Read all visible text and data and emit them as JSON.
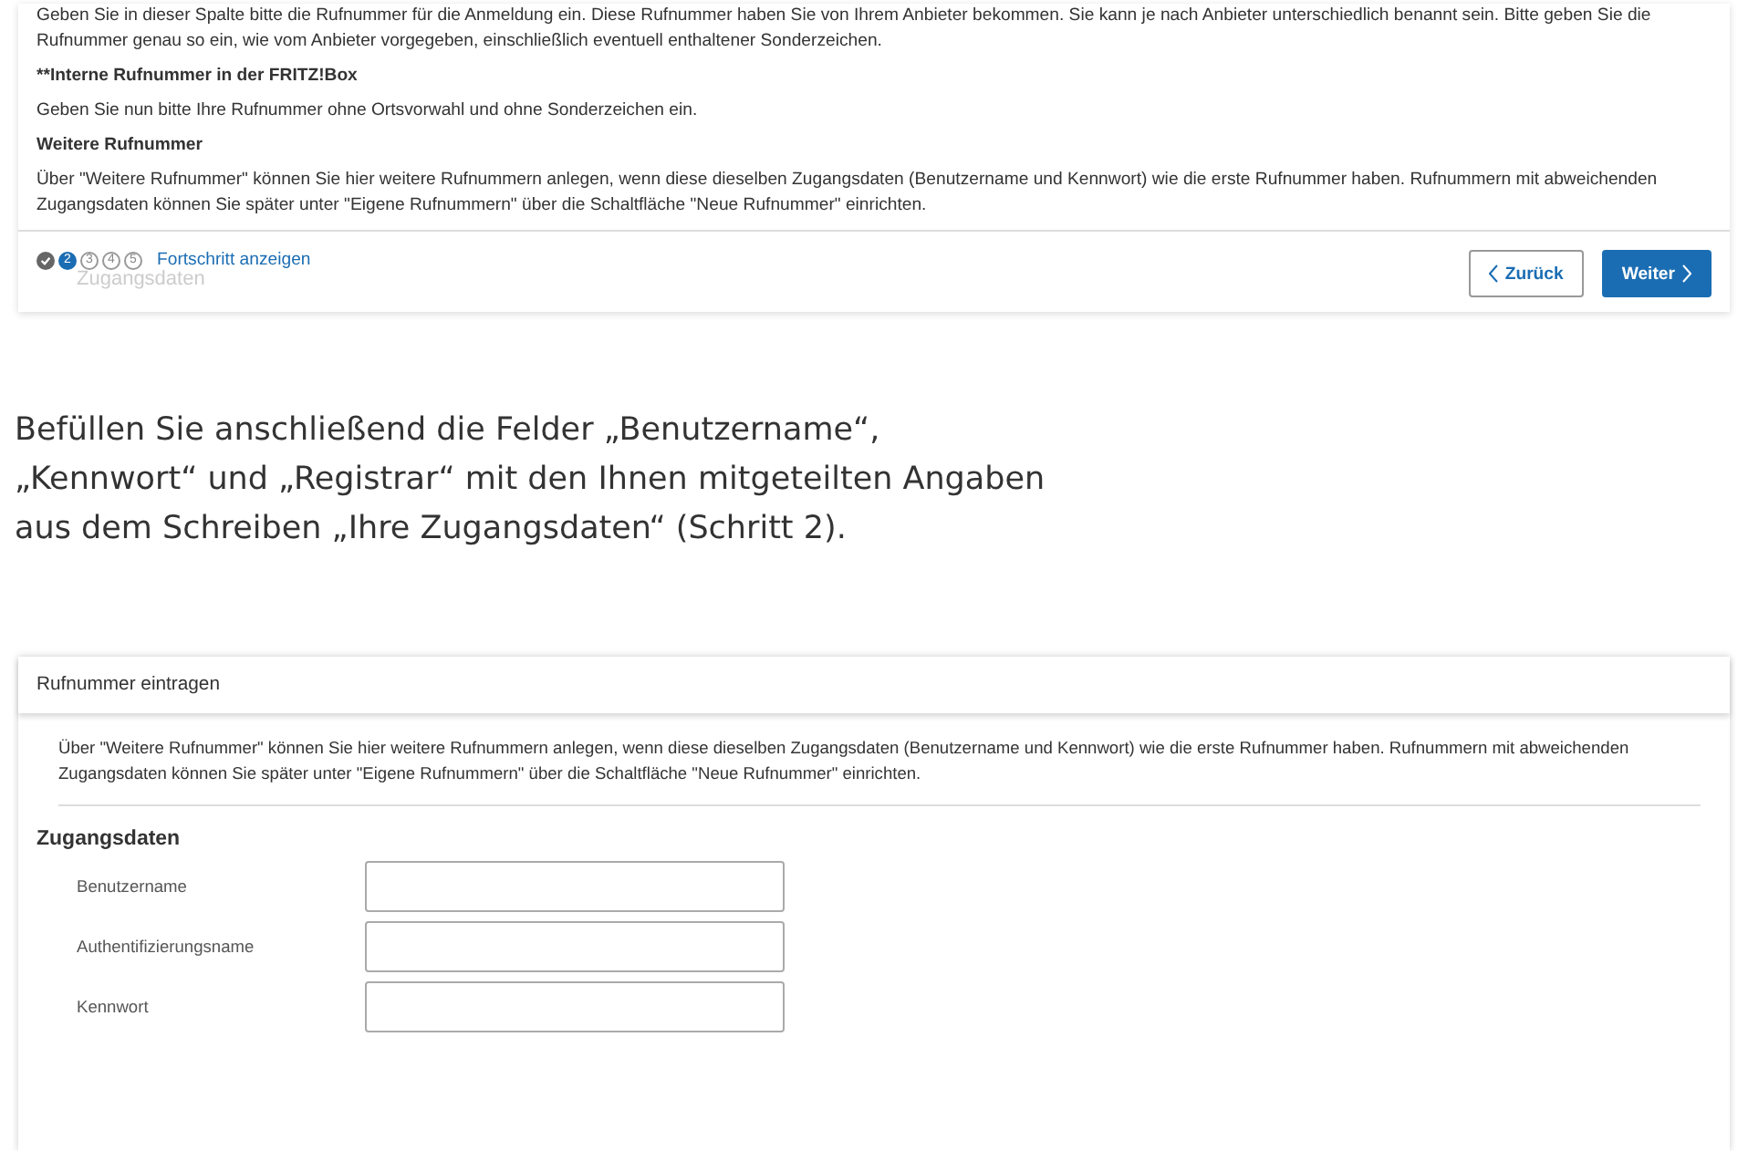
{
  "top_panel": {
    "paragraphs": [
      {
        "kind": "text",
        "text": "Geben Sie in dieser Spalte bitte die Rufnummer für die Anmeldung ein. Diese Rufnummer haben Sie von Ihrem Anbieter bekommen. Sie kann je nach Anbieter unterschiedlich benannt sein. Bitte geben Sie die Rufnummer genau so ein, wie vom Anbieter vorgegeben, einschließlich eventuell enthaltener Sonderzeichen."
      },
      {
        "kind": "heading",
        "text": "**Interne Rufnummer in der FRITZ!Box"
      },
      {
        "kind": "text",
        "text": "Geben Sie nun bitte Ihre Rufnummer ohne Ortsvorwahl und ohne Sonderzeichen ein."
      },
      {
        "kind": "heading",
        "text": "Weitere Rufnummer"
      },
      {
        "kind": "text",
        "text": "Über \"Weitere Rufnummer\" können Sie hier weitere Rufnummern anlegen, wenn diese dieselben Zugangsdaten (Benutzername und Kennwort) wie die erste Rufnummer haben. Rufnummern mit abweichenden Zugangsdaten können Sie später unter \"Eigene Rufnummern\" über die Schaltfläche \"Neue Rufnummer\" einrichten."
      }
    ],
    "progress": {
      "steps": [
        {
          "kind": "done"
        },
        {
          "kind": "current",
          "label": "2"
        },
        {
          "kind": "todo",
          "label": "3"
        },
        {
          "kind": "todo",
          "label": "4"
        },
        {
          "kind": "todo",
          "label": "5"
        }
      ],
      "link": "Fortschritt anzeigen",
      "step_name": "Zugangsdaten"
    },
    "back_button": "Zurück",
    "next_button": "Weiter"
  },
  "article": {
    "lines": [
      "Befüllen Sie anschließend die Felder „Benutzername“,",
      "„Kennwort“ und „Registrar“ mit den Ihnen mitgeteilten Angaben",
      "aus dem Schreiben „Ihre Zugangsdaten“ (Schritt 2)."
    ]
  },
  "bottom_panel": {
    "title": "Rufnummer eintragen",
    "info": "Über \"Weitere Rufnummer\" können Sie hier weitere Rufnummern anlegen, wenn diese dieselben Zugangsdaten (Benutzername und Kennwort) wie die erste Rufnummer haben. Rufnummern mit abweichenden Zugangsdaten können Sie später unter \"Eigene Rufnummern\" über die Schaltfläche \"Neue Rufnummer\" einrichten.",
    "section": "Zugangsdaten",
    "fields": [
      {
        "label": "Benutzername"
      },
      {
        "label": "Authentifizierungsname"
      },
      {
        "label": "Kennwort"
      }
    ]
  }
}
